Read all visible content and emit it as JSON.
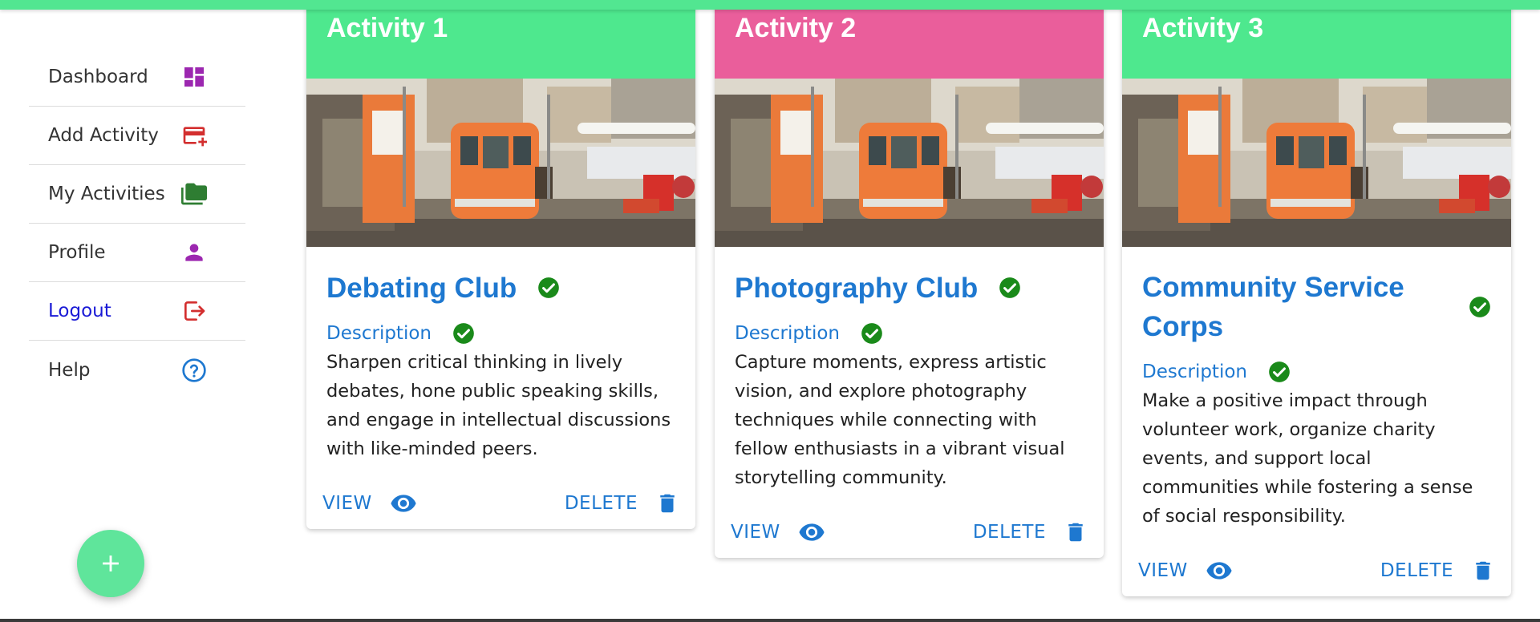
{
  "sidebar": {
    "items": [
      {
        "label": "Dashboard",
        "icon": "dashboard-icon",
        "color": "#9c27b0"
      },
      {
        "label": "Add Activity",
        "icon": "add-card-icon",
        "color": "#d32f2f"
      },
      {
        "label": "My Activities",
        "icon": "folder-icon",
        "color": "#2e7d32"
      },
      {
        "label": "Profile",
        "icon": "person-icon",
        "color": "#9c27b0"
      },
      {
        "label": "Logout",
        "icon": "logout-icon",
        "color": "#d32f2f"
      },
      {
        "label": "Help",
        "icon": "help-icon",
        "color": "#1e78d0"
      }
    ]
  },
  "fab": {
    "icon": "plus-icon",
    "color": "#5fe59b"
  },
  "cards": [
    {
      "header": "Activity 1",
      "header_color": "#4ee88e",
      "name": "Debating Club",
      "desc_label": "Description",
      "description": "Sharpen critical thinking in lively debates, hone public speaking skills, and engage in intellectual discussions with like-minded peers.",
      "view_label": "VIEW",
      "delete_label": "DELETE"
    },
    {
      "header": "Activity 2",
      "header_color": "#ea5e9b",
      "name": "Photography Club",
      "desc_label": "Description",
      "description": "Capture moments, express artistic vision, and explore photography techniques while connecting with fellow enthusiasts in a vibrant visual storytelling community.",
      "view_label": "VIEW",
      "delete_label": "DELETE"
    },
    {
      "header": "Activity 3",
      "header_color": "#4ee88e",
      "name": "Community Service Corps",
      "desc_label": "Description",
      "description": "Make a positive impact through volunteer work, organize charity events, and support local communities while fostering a sense of social responsibility.",
      "view_label": "VIEW",
      "delete_label": "DELETE"
    }
  ],
  "colors": {
    "accent_blue": "#1e78d0",
    "check_green": "#1a8a1a",
    "top_bar": "#52e691"
  }
}
